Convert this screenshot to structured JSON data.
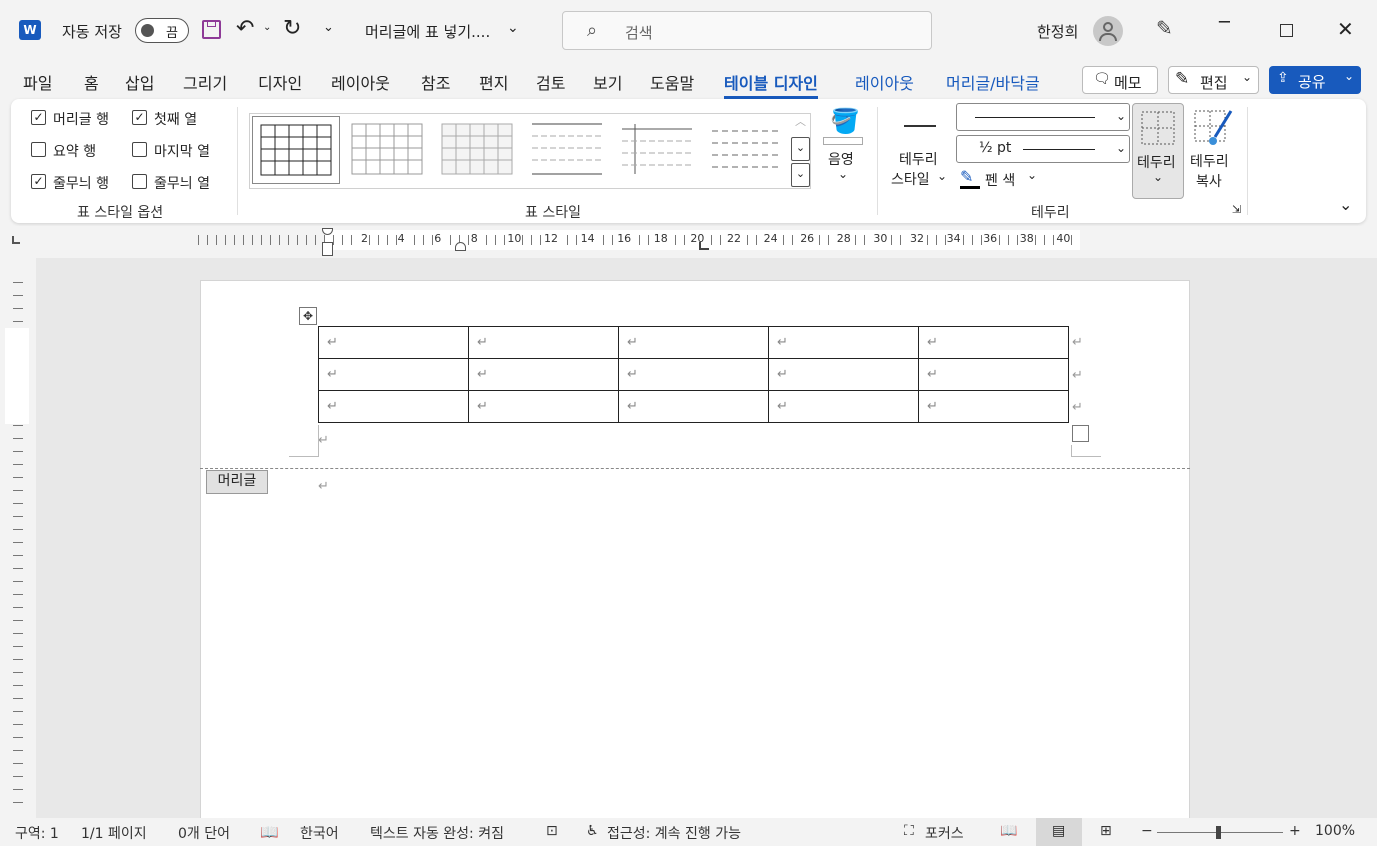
{
  "titlebar": {
    "autosave_label": "자동 저장",
    "autosave_state": "끔",
    "doc_title": "머리글에 표 넣기....",
    "search_placeholder": "검색",
    "user_name": "한정희"
  },
  "tabs": [
    "파일",
    "홈",
    "삽입",
    "그리기",
    "디자인",
    "레이아웃",
    "참조",
    "편지",
    "검토",
    "보기",
    "도움말",
    "테이블 디자인",
    "레이아웃",
    "머리글/바닥글"
  ],
  "tab_actions": {
    "memo": "메모",
    "edit": "편집",
    "share": "공유"
  },
  "style_options": {
    "items": [
      {
        "label": "머리글 행",
        "checked": true
      },
      {
        "label": "첫째 열",
        "checked": true
      },
      {
        "label": "요약 행",
        "checked": false
      },
      {
        "label": "마지막 열",
        "checked": false
      },
      {
        "label": "줄무늬 행",
        "checked": true
      },
      {
        "label": "줄무늬 열",
        "checked": false
      }
    ],
    "group_name": "표 스타일 옵션"
  },
  "table_styles": {
    "group_name": "표 스타일",
    "shading_label": "음영"
  },
  "borders": {
    "style_label_1": "테두리",
    "style_label_2": "스타일",
    "weight": "½ pt",
    "pen_color": "펜 색",
    "borders_btn": "테두리",
    "painter_1": "테두리",
    "painter_2": "복사",
    "group_name": "테두리"
  },
  "ruler": {
    "numbers": [
      "2",
      "4",
      "6",
      "8",
      "10",
      "12",
      "14",
      "16",
      "18",
      "20",
      "22",
      "24",
      "26",
      "28",
      "30",
      "32",
      "34",
      "36",
      "38",
      "40"
    ]
  },
  "document": {
    "header_tag": "머리글",
    "return_mark": "↵"
  },
  "status": {
    "section": "구역: 1",
    "pages": "1/1 페이지",
    "words": "0개 단어",
    "language": "한국어",
    "autocomplete": "텍스트 자동 완성: 켜짐",
    "accessibility": "접근성: 계속 진행 가능",
    "focus": "포커스",
    "zoom": "100%"
  }
}
